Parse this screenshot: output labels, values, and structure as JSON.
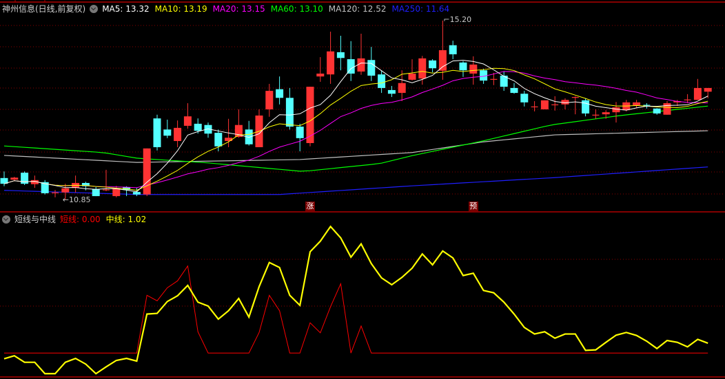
{
  "chart_data": {
    "type": "candlestick",
    "title": "神州信息(日线,前复权)",
    "ma_legend": [
      {
        "name": "MA5",
        "value": "13.32",
        "color": "#ffffff"
      },
      {
        "name": "MA10",
        "value": "13.19",
        "color": "#ffff00"
      },
      {
        "name": "MA20",
        "value": "13.15",
        "color": "#ff00ff"
      },
      {
        "name": "MA60",
        "value": "13.10",
        "color": "#00ff00"
      },
      {
        "name": "MA120",
        "value": "12.52",
        "color": "#c0c0c0"
      },
      {
        "name": "MA250",
        "value": "11.64",
        "color": "#1f1fff"
      }
    ],
    "colors": {
      "up": "#ff3333",
      "down": "#54ffff",
      "grid": "#8b0000",
      "border": "#b00000"
    },
    "price_range": [
      10.85,
      15.2
    ],
    "candles_ohlc": [
      [
        11.37,
        11.53,
        11.17,
        11.23
      ],
      [
        11.33,
        11.4,
        11.3,
        11.38
      ],
      [
        11.5,
        11.53,
        11.2,
        11.23
      ],
      [
        11.22,
        11.43,
        11.13,
        11.32
      ],
      [
        11.27,
        11.32,
        10.97,
        11.0
      ],
      [
        11.0,
        11.08,
        10.9,
        11.01
      ],
      [
        11.02,
        11.23,
        10.85,
        11.12
      ],
      [
        11.13,
        11.43,
        11.02,
        11.25
      ],
      [
        11.25,
        11.28,
        11.07,
        11.17
      ],
      [
        11.1,
        11.15,
        10.93,
        10.93
      ],
      [
        11.07,
        11.57,
        11.05,
        11.08
      ],
      [
        10.93,
        11.18,
        10.9,
        11.12
      ],
      [
        11.15,
        11.17,
        10.93,
        11.08
      ],
      [
        11.03,
        11.13,
        10.93,
        10.97
      ],
      [
        10.97,
        12.09,
        10.93,
        12.09
      ],
      [
        12.82,
        12.91,
        12.04,
        12.12
      ],
      [
        12.55,
        12.79,
        12.34,
        12.4
      ],
      [
        12.27,
        12.77,
        12.12,
        12.59
      ],
      [
        12.64,
        13.19,
        12.57,
        12.87
      ],
      [
        12.69,
        12.82,
        12.45,
        12.52
      ],
      [
        12.66,
        12.72,
        12.35,
        12.45
      ],
      [
        12.47,
        12.55,
        12.02,
        12.14
      ],
      [
        12.27,
        12.81,
        12.12,
        12.35
      ],
      [
        12.37,
        13.04,
        12.35,
        12.66
      ],
      [
        12.55,
        12.76,
        12.16,
        12.19
      ],
      [
        12.12,
        13.04,
        12.12,
        12.89
      ],
      [
        13.04,
        13.66,
        12.86,
        13.49
      ],
      [
        13.53,
        13.84,
        13.16,
        13.32
      ],
      [
        13.32,
        13.56,
        12.55,
        12.62
      ],
      [
        12.62,
        12.69,
        12.02,
        12.34
      ],
      [
        12.22,
        13.59,
        12.14,
        13.59
      ],
      [
        13.84,
        14.31,
        13.71,
        13.91
      ],
      [
        13.89,
        14.93,
        13.66,
        14.45
      ],
      [
        14.43,
        14.83,
        13.99,
        14.29
      ],
      [
        14.26,
        14.7,
        13.73,
        13.91
      ],
      [
        13.96,
        14.88,
        13.88,
        14.28
      ],
      [
        14.24,
        14.56,
        13.73,
        13.86
      ],
      [
        13.89,
        13.98,
        13.44,
        13.56
      ],
      [
        13.51,
        13.61,
        13.34,
        13.42
      ],
      [
        13.44,
        13.99,
        13.24,
        13.68
      ],
      [
        13.76,
        14.26,
        13.74,
        13.91
      ],
      [
        13.79,
        14.34,
        13.64,
        14.28
      ],
      [
        14.23,
        14.26,
        13.94,
        14.04
      ],
      [
        13.98,
        15.2,
        13.76,
        14.48
      ],
      [
        14.6,
        14.71,
        14.26,
        14.38
      ],
      [
        14.18,
        14.21,
        13.83,
        13.99
      ],
      [
        13.91,
        14.33,
        13.64,
        14.13
      ],
      [
        13.99,
        14.03,
        13.66,
        13.74
      ],
      [
        13.76,
        13.93,
        13.63,
        13.77
      ],
      [
        13.86,
        13.96,
        13.49,
        13.59
      ],
      [
        13.56,
        13.68,
        13.42,
        13.44
      ],
      [
        13.42,
        13.49,
        13.11,
        13.21
      ],
      [
        13.09,
        13.24,
        12.99,
        13.1
      ],
      [
        13.04,
        13.26,
        13.04,
        13.26
      ],
      [
        13.14,
        13.36,
        13.01,
        13.15
      ],
      [
        13.16,
        13.31,
        13.04,
        13.27
      ],
      [
        13.32,
        13.36,
        12.92,
        13.33
      ],
      [
        13.26,
        13.31,
        12.87,
        12.94
      ],
      [
        12.89,
        13.04,
        12.81,
        12.9
      ],
      [
        12.92,
        13.02,
        12.81,
        12.97
      ],
      [
        12.97,
        13.22,
        12.72,
        13.09
      ],
      [
        13.02,
        13.27,
        12.99,
        13.21
      ],
      [
        13.14,
        13.27,
        13.07,
        13.21
      ],
      [
        13.14,
        13.19,
        13.06,
        13.12
      ],
      [
        13.06,
        13.07,
        12.91,
        12.94
      ],
      [
        12.91,
        13.24,
        12.91,
        13.19
      ],
      [
        13.21,
        13.27,
        13.12,
        13.24
      ],
      [
        13.26,
        13.41,
        13.19,
        13.27
      ],
      [
        13.27,
        13.78,
        13.27,
        13.56
      ],
      [
        13.47,
        13.56,
        13.31,
        13.56
      ]
    ],
    "ma_long_knots": {
      "MA60": [
        [
          0,
          12.15
        ],
        [
          9.7,
          11.99
        ],
        [
          13.1,
          11.85
        ],
        [
          19.9,
          11.74
        ],
        [
          29.3,
          11.53
        ],
        [
          36.8,
          11.72
        ],
        [
          40.1,
          11.92
        ],
        [
          46.9,
          12.27
        ],
        [
          53.6,
          12.66
        ],
        [
          60.4,
          12.89
        ],
        [
          69,
          13.12
        ]
      ],
      "MA120": [
        [
          0,
          11.92
        ],
        [
          13,
          11.75
        ],
        [
          29,
          11.82
        ],
        [
          40,
          11.99
        ],
        [
          47,
          12.25
        ],
        [
          54,
          12.42
        ],
        [
          69,
          12.52
        ]
      ],
      "MA250": [
        [
          0,
          11.07
        ],
        [
          13,
          10.97
        ],
        [
          27,
          10.97
        ],
        [
          40,
          11.18
        ],
        [
          54,
          11.38
        ],
        [
          69,
          11.64
        ]
      ]
    },
    "high_label": "15.20",
    "high_index": 43,
    "low_label": "10.85",
    "low_index": 6,
    "markers": [
      {
        "index": 30,
        "label": "涨"
      },
      {
        "index": 46,
        "label": "预"
      }
    ],
    "indicator": {
      "title": "短线与中线",
      "short_label": "短线",
      "short_value": "0.00",
      "mid_label": "中线",
      "mid_value": "1.02",
      "short_color": "#ff0000",
      "mid_color": "#ffff00",
      "short": [
        0,
        0,
        0,
        0,
        0,
        0,
        0,
        0,
        0,
        0,
        0,
        0,
        0,
        0,
        5.97,
        5.4,
        6.75,
        7.46,
        9.0,
        2.2,
        0,
        0,
        0,
        0,
        0,
        2.13,
        5.97,
        4.38,
        0,
        0,
        3.13,
        2.09,
        4.79,
        7.16,
        0,
        2.8,
        0,
        0,
        0,
        0,
        0,
        0,
        0,
        0,
        0,
        0,
        0,
        0,
        0,
        0,
        0,
        0,
        0,
        0,
        0,
        0,
        0,
        0,
        0,
        0,
        0,
        0,
        0,
        0,
        0,
        0,
        0,
        0,
        0,
        0
      ],
      "mid": [
        -0.59,
        -0.28,
        -0.95,
        -0.95,
        -2.13,
        -2.13,
        -0.95,
        -0.55,
        -1.14,
        -2.13,
        -1.42,
        -0.76,
        -0.55,
        -0.83,
        4.03,
        4.1,
        5.33,
        5.92,
        6.99,
        5.26,
        4.86,
        3.51,
        4.38,
        5.64,
        3.72,
        6.87,
        9.36,
        8.84,
        5.97,
        4.93,
        10.47,
        11.56,
        13.08,
        11.9,
        9.91,
        11.28,
        9.24,
        7.77,
        7.06,
        7.82,
        8.77,
        10.24,
        9.12,
        10.55,
        9.83,
        8.01,
        8.25,
        6.47,
        6.23,
        5.26,
        4.03,
        2.65,
        1.97,
        2.2,
        1.54,
        1.97,
        1.97,
        0.28,
        0.33,
        1.11,
        1.85,
        2.13,
        1.82,
        1.23,
        0.47,
        1.3,
        1.11,
        0.64,
        1.42,
        1.02
      ]
    }
  }
}
